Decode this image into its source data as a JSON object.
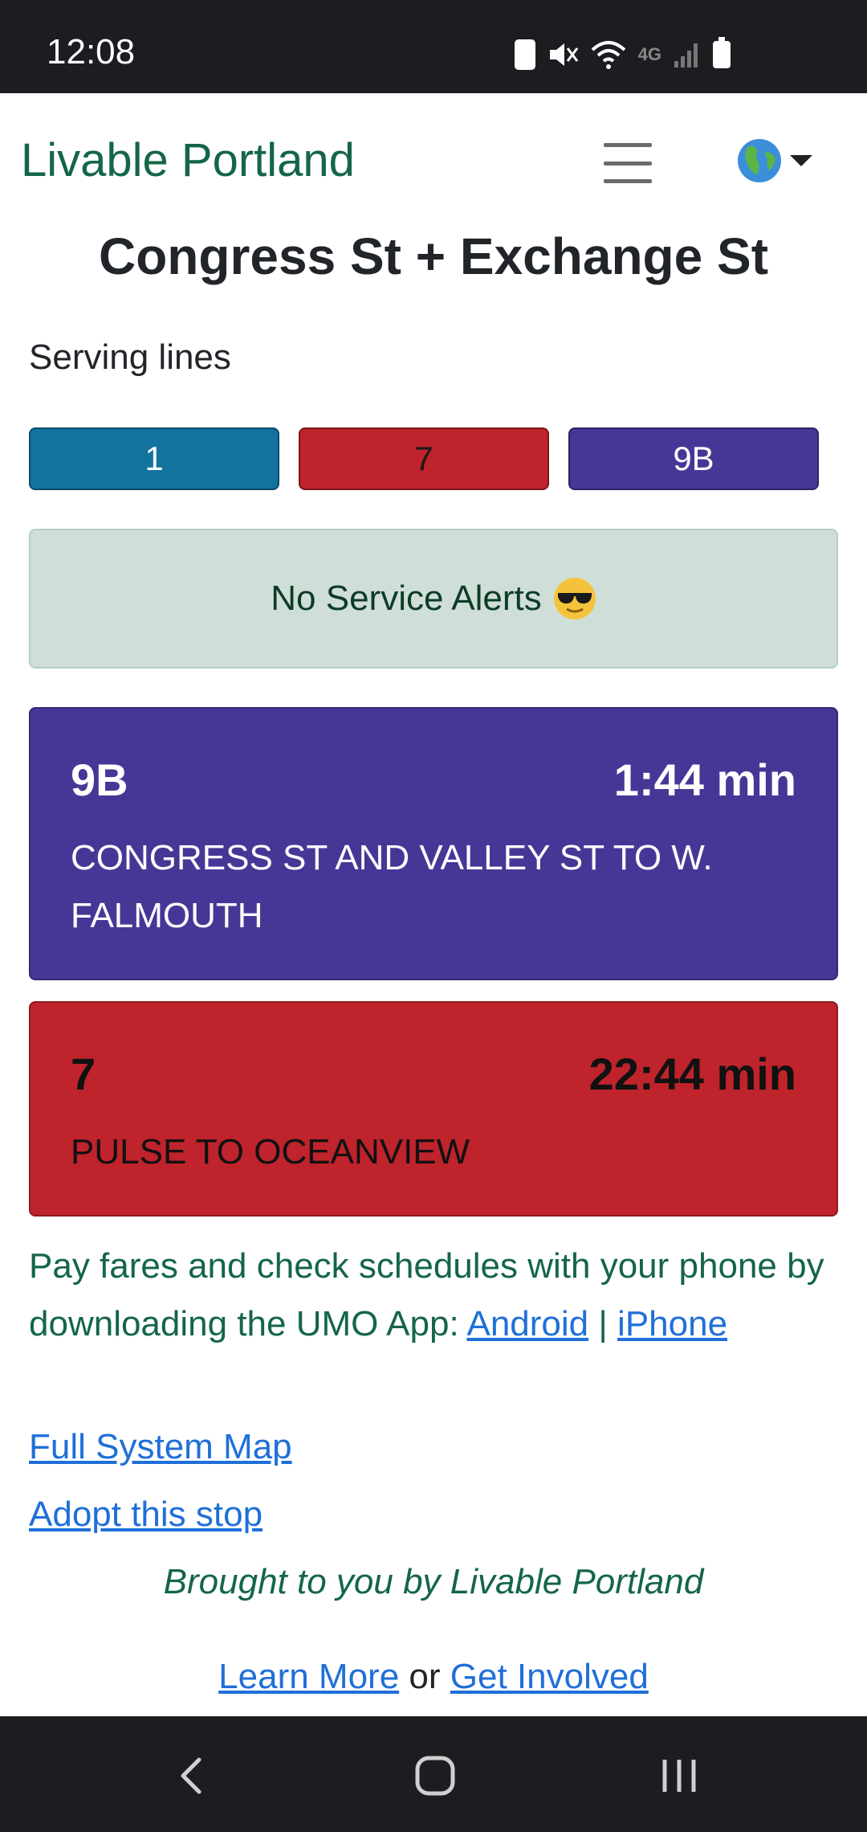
{
  "status_bar": {
    "time": "12:08",
    "network": "4G"
  },
  "navbar": {
    "brand": "Livable Portland"
  },
  "page": {
    "title": "Congress St + Exchange St",
    "serving_label": "Serving lines"
  },
  "lines": [
    {
      "label": "1",
      "color": "#13739f"
    },
    {
      "label": "7",
      "color": "#bf232b"
    },
    {
      "label": "9B",
      "color": "#463797"
    }
  ],
  "alerts": {
    "text": "No Service Alerts"
  },
  "arrivals": [
    {
      "route": "9B",
      "time": "1:44 min",
      "destination": "CONGRESS ST AND VALLEY ST TO W. FALMOUTH",
      "color": "#463797"
    },
    {
      "route": "7",
      "time": "22:44 min",
      "destination": "PULSE TO OCEANVIEW",
      "color": "#bf232b"
    }
  ],
  "info": {
    "text": "Pay fares and check schedules with your phone by downloading the UMO App:",
    "android_link": "Android",
    "separator": "|",
    "iphone_link": "iPhone"
  },
  "links": {
    "map": "Full System Map",
    "adopt": "Adopt this stop"
  },
  "footer": {
    "brought_by": "Brought to you by Livable Portland",
    "learn_more": "Learn More",
    "or": "or",
    "get_involved": "Get Involved"
  },
  "colors": {
    "brand_green": "#146646",
    "link_blue": "#1f6fd8",
    "alert_bg": "#cfdfd7"
  }
}
